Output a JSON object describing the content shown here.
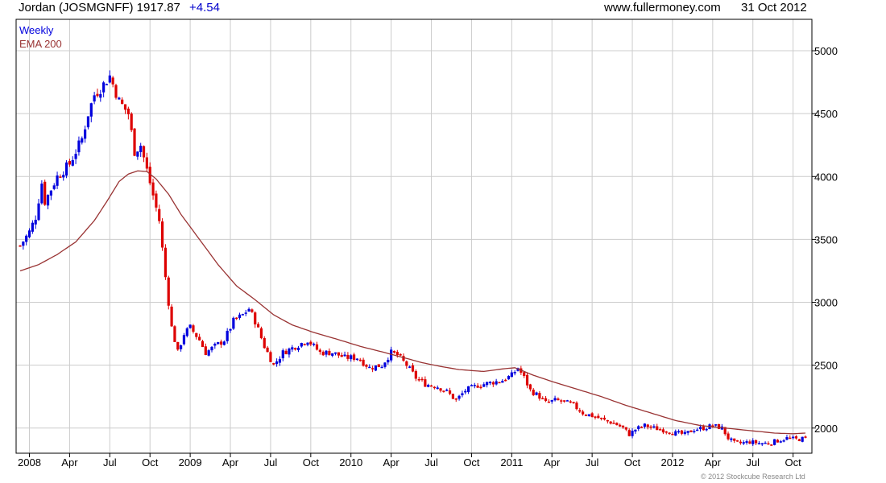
{
  "header": {
    "instrument": "Jordan (JOSMGNFF)",
    "last": "1917.87",
    "change": "+4.54",
    "source": "www.fullermoney.com",
    "date": "31 Oct 2012",
    "change_color": "#0000cc"
  },
  "copyright": "© 2012 Stockcube Research Ltd",
  "chart_data": {
    "type": "candlestick",
    "frequency_label": "Weekly",
    "overlay_label": "EMA 200",
    "colors": {
      "up": "#0000dd",
      "down": "#dd0000",
      "ema": "#993333",
      "grid": "#cccccc",
      "axis": "#000000"
    },
    "ylim": [
      1800,
      5250
    ],
    "yticks": [
      2000,
      2500,
      3000,
      3500,
      4000,
      4500,
      5000
    ],
    "y_axis_side": "right",
    "grid": true,
    "xticks": [
      {
        "label": "2008",
        "week": 3
      },
      {
        "label": "Apr",
        "week": 16
      },
      {
        "label": "Jul",
        "week": 29
      },
      {
        "label": "Oct",
        "week": 42
      },
      {
        "label": "2009",
        "week": 55
      },
      {
        "label": "Apr",
        "week": 68
      },
      {
        "label": "Jul",
        "week": 81
      },
      {
        "label": "Oct",
        "week": 94
      },
      {
        "label": "2010",
        "week": 107
      },
      {
        "label": "Apr",
        "week": 120
      },
      {
        "label": "Jul",
        "week": 133
      },
      {
        "label": "Oct",
        "week": 146
      },
      {
        "label": "2011",
        "week": 159
      },
      {
        "label": "Apr",
        "week": 172
      },
      {
        "label": "Jul",
        "week": 185
      },
      {
        "label": "Oct",
        "week": 198
      },
      {
        "label": "2012",
        "week": 211
      },
      {
        "label": "Apr",
        "week": 224
      },
      {
        "label": "Jul",
        "week": 237
      },
      {
        "label": "Oct",
        "week": 250
      }
    ],
    "close_keypoints": [
      [
        0,
        3450
      ],
      [
        3,
        3560
      ],
      [
        5,
        3680
      ],
      [
        7,
        3950
      ],
      [
        8,
        3800
      ],
      [
        12,
        4000
      ],
      [
        16,
        4100
      ],
      [
        20,
        4300
      ],
      [
        22,
        4500
      ],
      [
        24,
        4650
      ],
      [
        26,
        4700
      ],
      [
        29,
        4800
      ],
      [
        32,
        4600
      ],
      [
        35,
        4500
      ],
      [
        37,
        4200
      ],
      [
        39,
        4250
      ],
      [
        41,
        4050
      ],
      [
        43,
        3850
      ],
      [
        45,
        3650
      ],
      [
        47,
        3200
      ],
      [
        49,
        2800
      ],
      [
        51,
        2600
      ],
      [
        53,
        2750
      ],
      [
        55,
        2800
      ],
      [
        58,
        2700
      ],
      [
        60,
        2600
      ],
      [
        63,
        2650
      ],
      [
        66,
        2700
      ],
      [
        69,
        2850
      ],
      [
        72,
        2900
      ],
      [
        74,
        2950
      ],
      [
        76,
        2850
      ],
      [
        79,
        2650
      ],
      [
        82,
        2500
      ],
      [
        85,
        2600
      ],
      [
        89,
        2650
      ],
      [
        93,
        2700
      ],
      [
        97,
        2600
      ],
      [
        101,
        2600
      ],
      [
        105,
        2560
      ],
      [
        109,
        2560
      ],
      [
        113,
        2480
      ],
      [
        117,
        2500
      ],
      [
        120,
        2600
      ],
      [
        122,
        2580
      ],
      [
        125,
        2500
      ],
      [
        128,
        2400
      ],
      [
        131,
        2350
      ],
      [
        135,
        2330
      ],
      [
        138,
        2290
      ],
      [
        141,
        2220
      ],
      [
        144,
        2300
      ],
      [
        148,
        2340
      ],
      [
        152,
        2360
      ],
      [
        156,
        2380
      ],
      [
        159,
        2420
      ],
      [
        161,
        2480
      ],
      [
        163,
        2400
      ],
      [
        165,
        2300
      ],
      [
        168,
        2250
      ],
      [
        170,
        2200
      ],
      [
        173,
        2220
      ],
      [
        176,
        2210
      ],
      [
        179,
        2180
      ],
      [
        182,
        2120
      ],
      [
        186,
        2090
      ],
      [
        189,
        2060
      ],
      [
        192,
        2040
      ],
      [
        195,
        2000
      ],
      [
        197,
        1950
      ],
      [
        199,
        1990
      ],
      [
        202,
        2020
      ],
      [
        205,
        2000
      ],
      [
        209,
        1980
      ],
      [
        212,
        1960
      ],
      [
        215,
        1950
      ],
      [
        218,
        1990
      ],
      [
        221,
        2000
      ],
      [
        224,
        2020
      ],
      [
        227,
        2000
      ],
      [
        229,
        1920
      ],
      [
        231,
        1880
      ],
      [
        233,
        1880
      ],
      [
        236,
        1890
      ],
      [
        239,
        1880
      ],
      [
        242,
        1880
      ],
      [
        245,
        1900
      ],
      [
        248,
        1920
      ],
      [
        251,
        1910
      ],
      [
        254,
        1918
      ]
    ],
    "ema_keypoints": [
      [
        0,
        3250
      ],
      [
        6,
        3300
      ],
      [
        12,
        3380
      ],
      [
        18,
        3480
      ],
      [
        24,
        3650
      ],
      [
        28,
        3800
      ],
      [
        32,
        3960
      ],
      [
        35,
        4020
      ],
      [
        38,
        4045
      ],
      [
        41,
        4040
      ],
      [
        44,
        3980
      ],
      [
        48,
        3860
      ],
      [
        52,
        3700
      ],
      [
        58,
        3500
      ],
      [
        64,
        3300
      ],
      [
        70,
        3130
      ],
      [
        76,
        3020
      ],
      [
        82,
        2900
      ],
      [
        88,
        2820
      ],
      [
        95,
        2760
      ],
      [
        102,
        2710
      ],
      [
        110,
        2650
      ],
      [
        118,
        2600
      ],
      [
        124,
        2560
      ],
      [
        130,
        2520
      ],
      [
        136,
        2490
      ],
      [
        142,
        2465
      ],
      [
        150,
        2450
      ],
      [
        156,
        2470
      ],
      [
        160,
        2480
      ],
      [
        166,
        2420
      ],
      [
        172,
        2370
      ],
      [
        180,
        2310
      ],
      [
        188,
        2250
      ],
      [
        196,
        2180
      ],
      [
        204,
        2120
      ],
      [
        212,
        2060
      ],
      [
        220,
        2020
      ],
      [
        228,
        2000
      ],
      [
        236,
        1980
      ],
      [
        244,
        1960
      ],
      [
        250,
        1955
      ],
      [
        254,
        1960
      ]
    ]
  }
}
